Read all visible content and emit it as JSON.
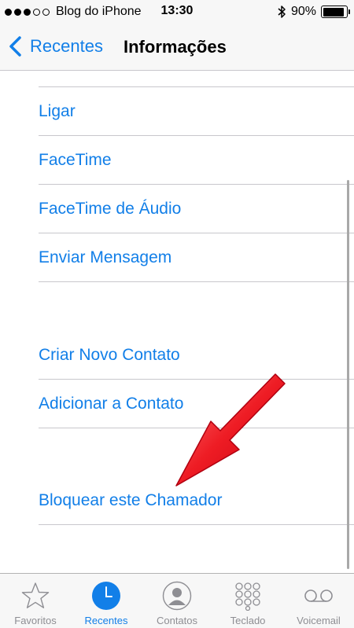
{
  "status_bar": {
    "carrier": "Blog do iPhone",
    "time": "13:30",
    "battery_percent": "90%",
    "signal_bars": 3,
    "signal_total": 5,
    "battery_level": 0.9,
    "bluetooth_icon": "bluetooth-icon"
  },
  "nav": {
    "back_label": "Recentes",
    "title": "Informações"
  },
  "actions": {
    "group1": [
      "Ligar",
      "FaceTime",
      "FaceTime de Áudio",
      "Enviar Mensagem"
    ],
    "group2": [
      "Criar Novo Contato",
      "Adicionar a Contato"
    ],
    "group3": [
      "Bloquear este Chamador"
    ]
  },
  "tab_bar": {
    "tabs": [
      {
        "label": "Favoritos",
        "icon": "star-icon"
      },
      {
        "label": "Recentes",
        "icon": "clock-icon",
        "active": true
      },
      {
        "label": "Contatos",
        "icon": "person-icon"
      },
      {
        "label": "Teclado",
        "icon": "keypad-icon"
      },
      {
        "label": "Voicemail",
        "icon": "voicemail-icon"
      }
    ]
  },
  "colors": {
    "accent": "#127fe8",
    "annotation_arrow": "#e8141c",
    "separator": "#c8c7cc"
  }
}
